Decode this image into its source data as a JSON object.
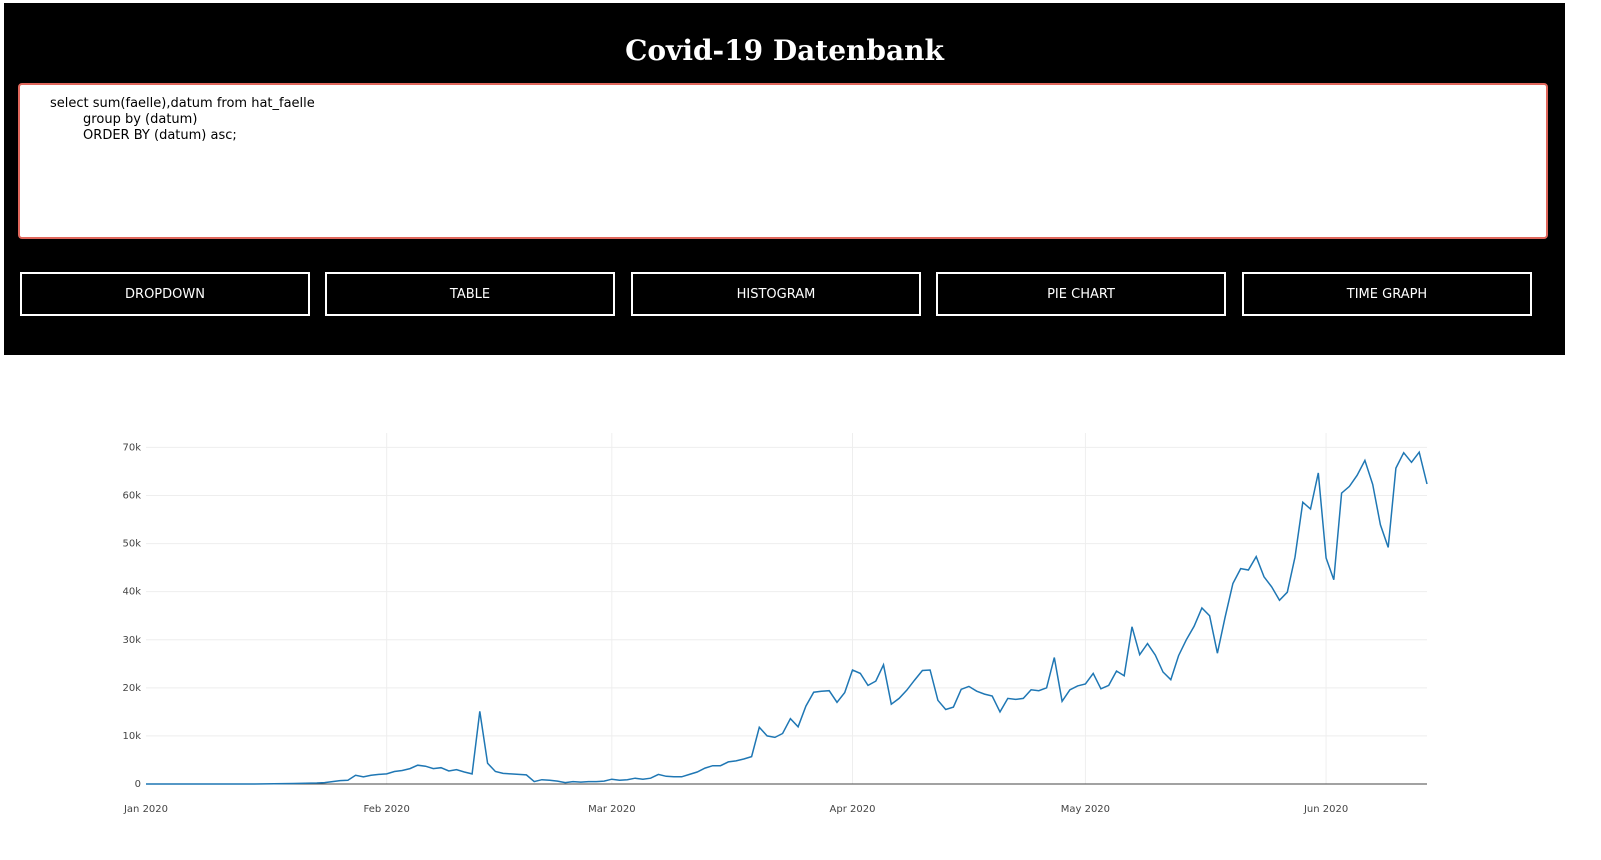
{
  "header": {
    "title": "Covid-19 Datenbank",
    "query": "select sum(faelle),datum from hat_faelle\n        group by (datum)\n        ORDER BY (datum) asc;"
  },
  "buttons": [
    "DROPDOWN",
    "TABLE",
    "HISTOGRAM",
    "PIE CHART",
    "TIME GRAPH"
  ],
  "colors": {
    "header_bg": "#000000",
    "query_border": "#e0675c",
    "line": "#1f77b4",
    "grid": "#eeeeee"
  },
  "chart_data": {
    "type": "line",
    "title": "",
    "xlabel": "",
    "ylabel": "",
    "x_start": "2020-01-01",
    "x_end": "2020-06-13",
    "x_ticks": [
      {
        "date": "2020-01-01",
        "label": "Jan 2020"
      },
      {
        "date": "2020-02-01",
        "label": "Feb 2020"
      },
      {
        "date": "2020-03-01",
        "label": "Mar 2020"
      },
      {
        "date": "2020-04-01",
        "label": "Apr 2020"
      },
      {
        "date": "2020-05-01",
        "label": "May 2020"
      },
      {
        "date": "2020-06-01",
        "label": "Jun 2020"
      }
    ],
    "y_ticks": [
      {
        "value": 0,
        "label": "0"
      },
      {
        "value": 10000,
        "label": "10k"
      },
      {
        "value": 20000,
        "label": "20k"
      },
      {
        "value": 30000,
        "label": "30k"
      },
      {
        "value": 40000,
        "label": "40k"
      },
      {
        "value": 50000,
        "label": "50k"
      },
      {
        "value": 60000,
        "label": "60k"
      },
      {
        "value": 70000,
        "label": "70k"
      }
    ],
    "ylim": [
      0,
      73000
    ],
    "grid": true,
    "series": [
      {
        "values": [
          [
            "2020-01-01",
            0
          ],
          [
            "2020-01-05",
            0
          ],
          [
            "2020-01-10",
            0
          ],
          [
            "2020-01-15",
            0
          ],
          [
            "2020-01-20",
            100
          ],
          [
            "2020-01-23",
            200
          ],
          [
            "2020-01-24",
            300
          ],
          [
            "2020-01-25",
            500
          ],
          [
            "2020-01-26",
            700
          ],
          [
            "2020-01-27",
            800
          ],
          [
            "2020-01-28",
            1800
          ],
          [
            "2020-01-29",
            1500
          ],
          [
            "2020-01-30",
            1800
          ],
          [
            "2020-01-31",
            2000
          ],
          [
            "2020-02-01",
            2100
          ],
          [
            "2020-02-02",
            2600
          ],
          [
            "2020-02-03",
            2800
          ],
          [
            "2020-02-04",
            3200
          ],
          [
            "2020-02-05",
            3900
          ],
          [
            "2020-02-06",
            3700
          ],
          [
            "2020-02-07",
            3200
          ],
          [
            "2020-02-08",
            3400
          ],
          [
            "2020-02-09",
            2700
          ],
          [
            "2020-02-10",
            3000
          ],
          [
            "2020-02-11",
            2500
          ],
          [
            "2020-02-12",
            2100
          ],
          [
            "2020-02-13",
            15100
          ],
          [
            "2020-02-14",
            4300
          ],
          [
            "2020-02-15",
            2600
          ],
          [
            "2020-02-16",
            2200
          ],
          [
            "2020-02-17",
            2100
          ],
          [
            "2020-02-18",
            2000
          ],
          [
            "2020-02-19",
            1900
          ],
          [
            "2020-02-20",
            500
          ],
          [
            "2020-02-21",
            900
          ],
          [
            "2020-02-22",
            800
          ],
          [
            "2020-02-23",
            600
          ],
          [
            "2020-02-24",
            300
          ],
          [
            "2020-02-25",
            500
          ],
          [
            "2020-02-26",
            400
          ],
          [
            "2020-02-27",
            500
          ],
          [
            "2020-02-28",
            500
          ],
          [
            "2020-02-29",
            600
          ],
          [
            "2020-03-01",
            1000
          ],
          [
            "2020-03-02",
            800
          ],
          [
            "2020-03-03",
            900
          ],
          [
            "2020-03-04",
            1200
          ],
          [
            "2020-03-05",
            1000
          ],
          [
            "2020-03-06",
            1200
          ],
          [
            "2020-03-07",
            2000
          ],
          [
            "2020-03-08",
            1600
          ],
          [
            "2020-03-09",
            1500
          ],
          [
            "2020-03-10",
            1500
          ],
          [
            "2020-03-11",
            2000
          ],
          [
            "2020-03-12",
            2500
          ],
          [
            "2020-03-13",
            3300
          ],
          [
            "2020-03-14",
            3800
          ],
          [
            "2020-03-15",
            3800
          ],
          [
            "2020-03-16",
            4600
          ],
          [
            "2020-03-17",
            4800
          ],
          [
            "2020-03-18",
            5200
          ],
          [
            "2020-03-19",
            5700
          ],
          [
            "2020-03-20",
            11800
          ],
          [
            "2020-03-21",
            10000
          ],
          [
            "2020-03-22",
            9700
          ],
          [
            "2020-03-23",
            10500
          ],
          [
            "2020-03-24",
            13600
          ],
          [
            "2020-03-25",
            11900
          ],
          [
            "2020-03-26",
            16200
          ],
          [
            "2020-03-27",
            19100
          ],
          [
            "2020-03-28",
            19300
          ],
          [
            "2020-03-29",
            19400
          ],
          [
            "2020-03-30",
            17000
          ],
          [
            "2020-03-31",
            19000
          ],
          [
            "2020-04-01",
            23700
          ],
          [
            "2020-04-02",
            23000
          ],
          [
            "2020-04-03",
            20500
          ],
          [
            "2020-04-04",
            21400
          ],
          [
            "2020-04-05",
            24800
          ],
          [
            "2020-04-06",
            16600
          ],
          [
            "2020-04-07",
            17800
          ],
          [
            "2020-04-08",
            19500
          ],
          [
            "2020-04-09",
            21600
          ],
          [
            "2020-04-10",
            23600
          ],
          [
            "2020-04-11",
            23700
          ],
          [
            "2020-04-12",
            17400
          ],
          [
            "2020-04-13",
            15500
          ],
          [
            "2020-04-14",
            16000
          ],
          [
            "2020-04-15",
            19700
          ],
          [
            "2020-04-16",
            20300
          ],
          [
            "2020-04-17",
            19300
          ],
          [
            "2020-04-18",
            18700
          ],
          [
            "2020-04-19",
            18300
          ],
          [
            "2020-04-20",
            15000
          ],
          [
            "2020-04-21",
            17800
          ],
          [
            "2020-04-22",
            17600
          ],
          [
            "2020-04-23",
            17800
          ],
          [
            "2020-04-24",
            19600
          ],
          [
            "2020-04-25",
            19400
          ],
          [
            "2020-04-26",
            20000
          ],
          [
            "2020-04-27",
            26300
          ],
          [
            "2020-04-28",
            17200
          ],
          [
            "2020-04-29",
            19600
          ],
          [
            "2020-04-30",
            20400
          ],
          [
            "2020-05-01",
            20800
          ],
          [
            "2020-05-02",
            23000
          ],
          [
            "2020-05-03",
            19800
          ],
          [
            "2020-05-04",
            20500
          ],
          [
            "2020-05-05",
            23500
          ],
          [
            "2020-05-06",
            22500
          ],
          [
            "2020-05-07",
            32700
          ],
          [
            "2020-05-08",
            26900
          ],
          [
            "2020-05-09",
            29200
          ],
          [
            "2020-05-10",
            26800
          ],
          [
            "2020-05-11",
            23300
          ],
          [
            "2020-05-12",
            21700
          ],
          [
            "2020-05-13",
            26700
          ],
          [
            "2020-05-14",
            30000
          ],
          [
            "2020-05-15",
            32800
          ],
          [
            "2020-05-16",
            36600
          ],
          [
            "2020-05-17",
            35000
          ],
          [
            "2020-05-18",
            27200
          ],
          [
            "2020-05-19",
            34700
          ],
          [
            "2020-05-20",
            41700
          ],
          [
            "2020-05-21",
            44800
          ],
          [
            "2020-05-22",
            44500
          ],
          [
            "2020-05-23",
            47300
          ],
          [
            "2020-05-24",
            43100
          ],
          [
            "2020-05-25",
            41000
          ],
          [
            "2020-05-26",
            38200
          ],
          [
            "2020-05-27",
            39900
          ],
          [
            "2020-05-28",
            47200
          ],
          [
            "2020-05-29",
            58600
          ],
          [
            "2020-05-30",
            57200
          ],
          [
            "2020-05-31",
            64700
          ],
          [
            "2020-06-01",
            47000
          ],
          [
            "2020-06-02",
            42500
          ],
          [
            "2020-06-03",
            60500
          ],
          [
            "2020-06-04",
            61900
          ],
          [
            "2020-06-05",
            64200
          ],
          [
            "2020-06-06",
            67300
          ],
          [
            "2020-06-07",
            62300
          ],
          [
            "2020-06-08",
            53900
          ],
          [
            "2020-06-09",
            49200
          ],
          [
            "2020-06-10",
            65700
          ],
          [
            "2020-06-11",
            68900
          ],
          [
            "2020-06-12",
            66900
          ],
          [
            "2020-06-13",
            69000
          ],
          [
            "2020-06-14",
            62400
          ]
        ]
      }
    ]
  }
}
